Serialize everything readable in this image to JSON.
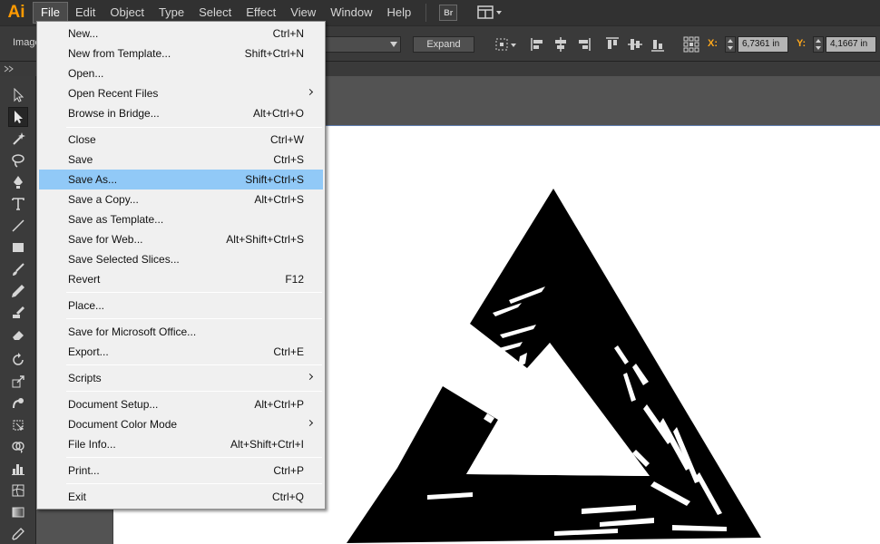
{
  "app": {
    "logo": "Ai"
  },
  "menubar": {
    "items": [
      "File",
      "Edit",
      "Object",
      "Type",
      "Select",
      "Effect",
      "View",
      "Window",
      "Help"
    ],
    "bridge_label": "Br"
  },
  "controlbar": {
    "label": "Image",
    "expand_label": "Expand",
    "x_label": "X:",
    "x_value": "6,7361 in",
    "y_label": "Y:",
    "y_value": "4,1667 in"
  },
  "file_menu": {
    "items": [
      {
        "label": "New...",
        "shortcut": "Ctrl+N"
      },
      {
        "label": "New from Template...",
        "shortcut": "Shift+Ctrl+N"
      },
      {
        "label": "Open...",
        "shortcut": ""
      },
      {
        "label": "Open Recent Files",
        "shortcut": ""
      },
      {
        "label": "Browse in Bridge...",
        "shortcut": "Alt+Ctrl+O"
      },
      {
        "label": "Close",
        "shortcut": "Ctrl+W"
      },
      {
        "label": "Save",
        "shortcut": "Ctrl+S"
      },
      {
        "label": "Save As...",
        "shortcut": "Shift+Ctrl+S"
      },
      {
        "label": "Save a Copy...",
        "shortcut": "Alt+Ctrl+S"
      },
      {
        "label": "Save as Template...",
        "shortcut": ""
      },
      {
        "label": "Save for Web...",
        "shortcut": "Alt+Shift+Ctrl+S"
      },
      {
        "label": "Save Selected Slices...",
        "shortcut": ""
      },
      {
        "label": "Revert",
        "shortcut": "F12"
      },
      {
        "label": "Place...",
        "shortcut": ""
      },
      {
        "label": "Save for Microsoft Office...",
        "shortcut": ""
      },
      {
        "label": "Export...",
        "shortcut": "Ctrl+E"
      },
      {
        "label": "Scripts",
        "shortcut": ""
      },
      {
        "label": "Document Setup...",
        "shortcut": "Alt+Ctrl+P"
      },
      {
        "label": "Document Color Mode",
        "shortcut": ""
      },
      {
        "label": "File Info...",
        "shortcut": "Alt+Shift+Ctrl+I"
      },
      {
        "label": "Print...",
        "shortcut": "Ctrl+P"
      },
      {
        "label": "Exit",
        "shortcut": "Ctrl+Q"
      }
    ],
    "highlighted": "Save As..."
  },
  "tools": [
    "selection-tool-icon",
    "direct-selection-tool-icon",
    "magic-wand-tool-icon",
    "lasso-tool-icon",
    "pen-tool-icon",
    "type-tool-icon",
    "line-tool-icon",
    "rectangle-tool-icon",
    "paintbrush-tool-icon",
    "pencil-tool-icon",
    "blob-brush-tool-icon",
    "eraser-tool-icon",
    "rotate-tool-icon",
    "scale-tool-icon",
    "warp-tool-icon",
    "free-transform-tool-icon",
    "shape-builder-tool-icon",
    "graph-tool-icon",
    "mesh-tool-icon",
    "gradient-tool-icon",
    "eyedropper-tool-icon"
  ],
  "colors": {
    "highlight": "#91c9f7",
    "logo": "#ff9a00",
    "coord_label": "#ffa81c"
  }
}
